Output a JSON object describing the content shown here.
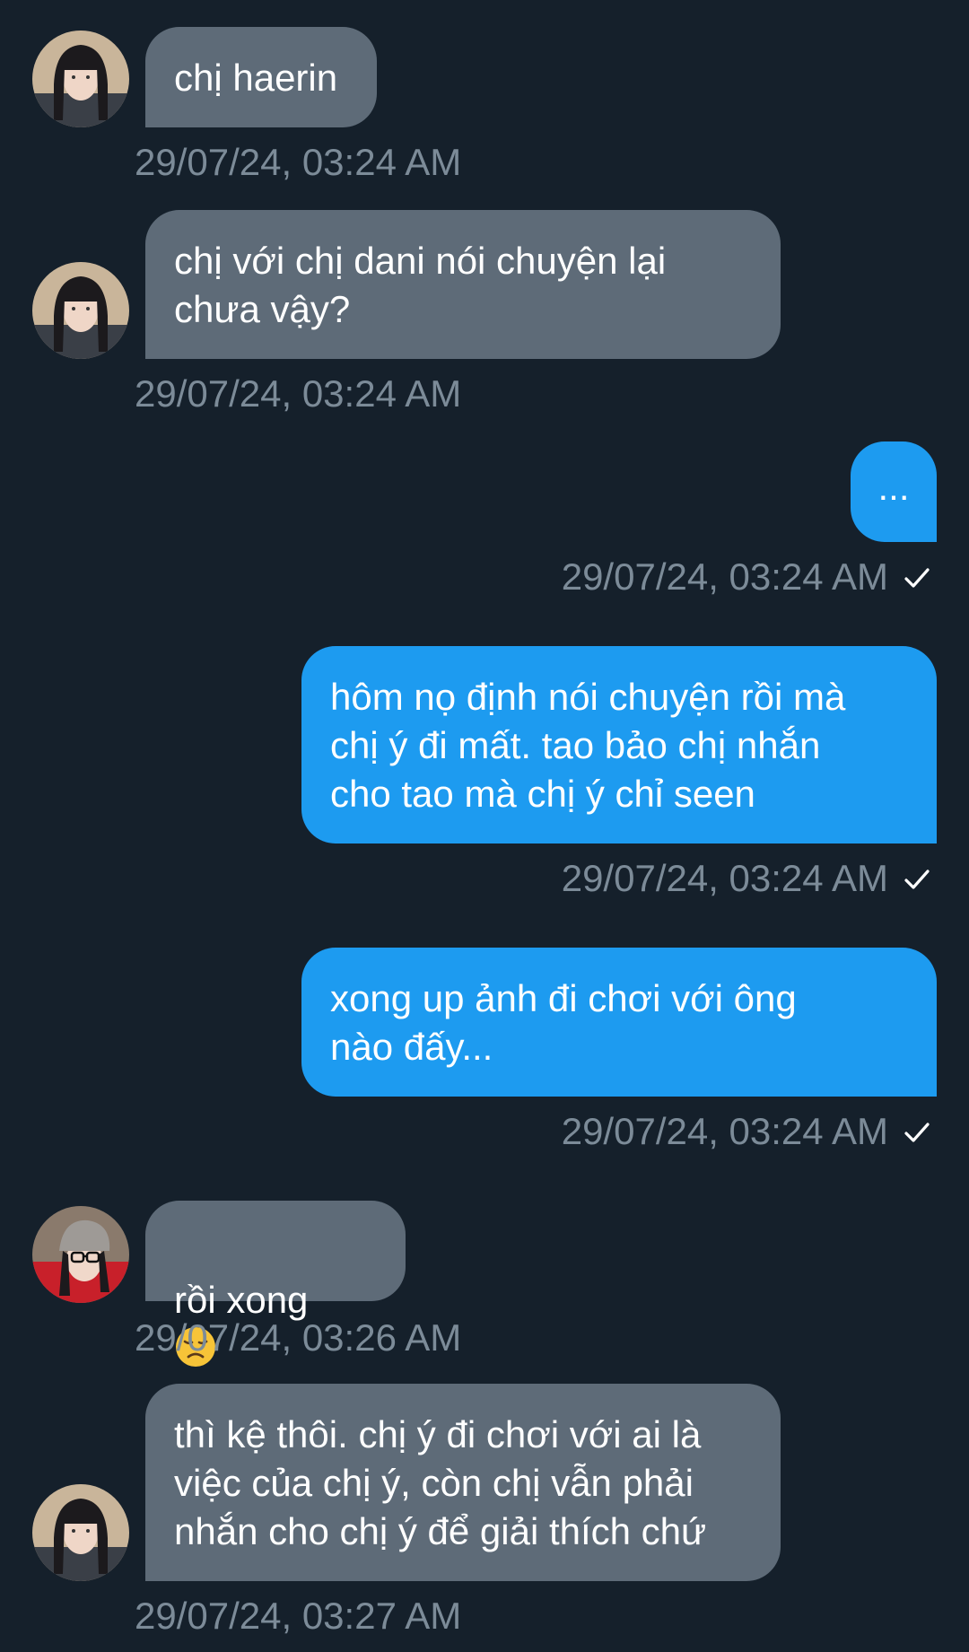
{
  "theme": {
    "background": "#15202b",
    "incoming_bubble": "#5e6b78",
    "outgoing_bubble": "#1d9bf0",
    "timestamp_color": "#7c8b98"
  },
  "messages": [
    {
      "direction": "in",
      "avatar": "avatar-girl-bangs",
      "text": "chị haerin",
      "timestamp": "29/07/24, 03:24 AM"
    },
    {
      "direction": "in",
      "avatar": "avatar-girl-bangs",
      "text": "chị với chị dani nói chuyện lại\nchưa vậy?",
      "timestamp": "29/07/24, 03:24 AM"
    },
    {
      "direction": "out",
      "text": "...",
      "timestamp": "29/07/24, 03:24 AM",
      "status_icon": "checkmark-icon"
    },
    {
      "direction": "out",
      "text": "hôm nọ định nói chuyện rồi mà\nchị ý đi mất. tao bảo chị nhắn\ncho tao mà chị ý chỉ seen",
      "timestamp": "29/07/24, 03:24 AM",
      "status_icon": "checkmark-icon"
    },
    {
      "direction": "out",
      "text": "xong up ảnh đi chơi với ông\nnào đấy...",
      "timestamp": "29/07/24, 03:24 AM",
      "status_icon": "checkmark-icon"
    },
    {
      "direction": "in",
      "avatar": "avatar-girl-beanie",
      "text": "rồi xong",
      "emoji": "disappointed-face-emoji",
      "timestamp": "29/07/24, 03:26 AM"
    },
    {
      "direction": "in",
      "avatar": "avatar-girl-bangs",
      "text": "thì kệ thôi. chị ý đi chơi với ai là\nviệc của chị ý, còn chị vẫn phải\nnhắn cho chị ý để giải thích chứ",
      "timestamp": "29/07/24, 03:27 AM"
    }
  ]
}
